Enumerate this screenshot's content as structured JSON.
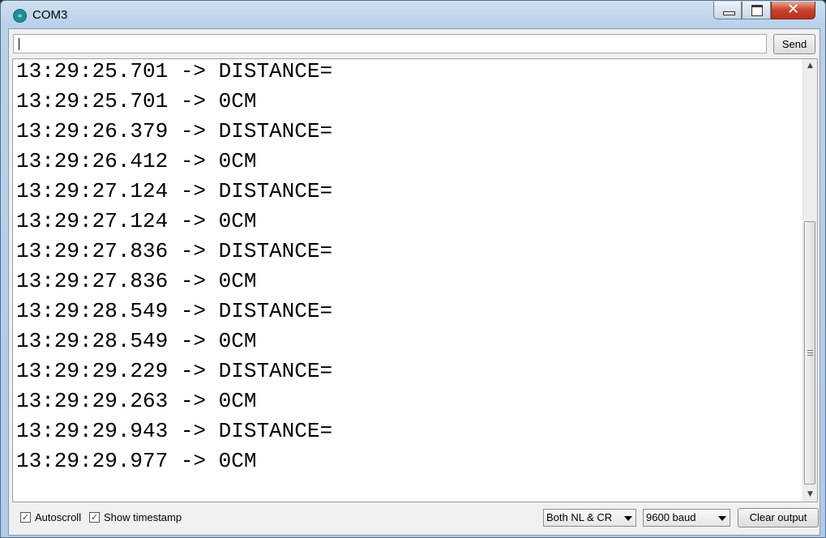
{
  "window": {
    "title": "COM3",
    "app_icon": "arduino-icon",
    "close_glyph": "✕"
  },
  "toolbar": {
    "input_value": "",
    "send_label": "Send"
  },
  "output": {
    "lines": [
      "13:29:25.701 -> DISTANCE=",
      "13:29:25.701 -> 0CM",
      "13:29:26.379 -> DISTANCE=",
      "13:29:26.412 -> 0CM",
      "13:29:27.124 -> DISTANCE=",
      "13:29:27.124 -> 0CM",
      "13:29:27.836 -> DISTANCE=",
      "13:29:27.836 -> 0CM",
      "13:29:28.549 -> DISTANCE=",
      "13:29:28.549 -> 0CM",
      "13:29:29.229 -> DISTANCE=",
      "13:29:29.263 -> 0CM",
      "13:29:29.943 -> DISTANCE=",
      "13:29:29.977 -> 0CM"
    ]
  },
  "footer": {
    "autoscroll_label": "Autoscroll",
    "autoscroll_checked": true,
    "timestamp_label": "Show timestamp",
    "timestamp_checked": true,
    "line_ending": "Both NL & CR",
    "baud_rate": "9600 baud",
    "clear_label": "Clear output"
  }
}
